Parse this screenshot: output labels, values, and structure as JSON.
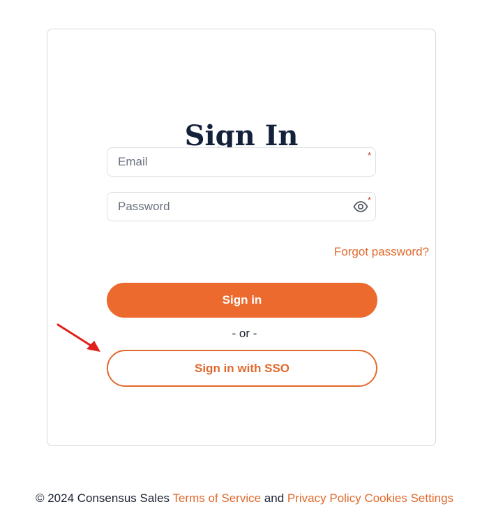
{
  "signin": {
    "title": "Sign In",
    "email_placeholder": "Email",
    "password_placeholder": "Password",
    "required_mark": "*",
    "forgot_label": "Forgot password?",
    "signin_label": "Sign in",
    "or_label": "- or -",
    "sso_label": "Sign in with SSO"
  },
  "footer": {
    "copyright": "© 2024 Consensus Sales",
    "terms_label": "Terms of Service",
    "and_label": "and",
    "privacy_label": "Privacy Policy",
    "cookies_label": "Cookies Settings"
  },
  "icons": {
    "password_toggle": "eye-icon",
    "annotation": "red-arrow-icon"
  },
  "colors": {
    "accent": "#ec6a2e",
    "link": "#e06a2e",
    "required": "#c0392b",
    "annotation_arrow": "#e0201b",
    "title": "#14213a"
  }
}
